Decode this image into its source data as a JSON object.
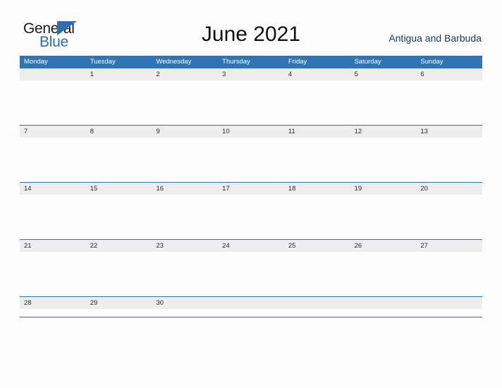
{
  "brand": {
    "name_top": "General",
    "name_bottom": "Blue",
    "accent_color": "#2b6fb0"
  },
  "header": {
    "title": "June 2021",
    "region": "Antigua and Barbuda"
  },
  "theme": {
    "header_blue": "#2f74b5",
    "row_gray": "#ededed",
    "page_background": "#fdfdfd",
    "date_text": "#2a2a2a"
  },
  "calendar": {
    "month": "June",
    "year": "2021",
    "weekday_headers": [
      "Monday",
      "Tuesday",
      "Wednesday",
      "Thursday",
      "Friday",
      "Saturday",
      "Sunday"
    ],
    "weeks": [
      [
        "",
        "1",
        "2",
        "3",
        "4",
        "5",
        "6"
      ],
      [
        "7",
        "8",
        "9",
        "10",
        "11",
        "12",
        "13"
      ],
      [
        "14",
        "15",
        "16",
        "17",
        "18",
        "19",
        "20"
      ],
      [
        "21",
        "22",
        "23",
        "24",
        "25",
        "26",
        "27"
      ],
      [
        "28",
        "29",
        "30",
        "",
        "",
        "",
        ""
      ]
    ]
  }
}
